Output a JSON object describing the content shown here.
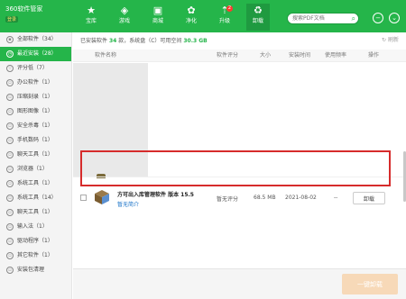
{
  "app": {
    "name": "360软件管家",
    "sub": "登录"
  },
  "nav": [
    {
      "label": "宝库",
      "icon": "star-icon",
      "glyph": "★"
    },
    {
      "label": "游戏",
      "icon": "gamepad-icon",
      "glyph": "🎮"
    },
    {
      "label": "商城",
      "icon": "shop-icon",
      "glyph": "▣"
    },
    {
      "label": "净化",
      "icon": "purify-icon",
      "glyph": "✿"
    },
    {
      "label": "升级",
      "icon": "upgrade-icon",
      "glyph": "⇡",
      "badge": "2"
    },
    {
      "label": "卸载",
      "icon": "trash-icon",
      "glyph": "🗑"
    }
  ],
  "search": {
    "placeholder": "搜索PDF文档"
  },
  "sidebar": {
    "items": [
      {
        "label": "全部软件（34）"
      },
      {
        "label": "最近安装（28）"
      },
      {
        "label": "评分低（7）"
      },
      {
        "label": "办公软件（1）"
      },
      {
        "label": "压缩刻录（1）"
      },
      {
        "label": "图形图像（1）"
      },
      {
        "label": "安全杀毒（1）"
      },
      {
        "label": "手机数码（1）"
      },
      {
        "label": "聊天工具（1）"
      },
      {
        "label": "浏览器（1）"
      },
      {
        "label": "系统工具（1）"
      },
      {
        "label": "系统工具（14）"
      },
      {
        "label": "聊天工具（1）"
      },
      {
        "label": "输入法（1）"
      },
      {
        "label": "驱动程序（1）"
      },
      {
        "label": "其它软件（1）"
      },
      {
        "label": "安装包清理"
      }
    ]
  },
  "summary": {
    "pre": "已安装软件",
    "count": "34",
    "mid": "款，系统盘（C）可用空间",
    "free": "30.3 GB"
  },
  "refresh_label": "刷新",
  "columns": {
    "name": "软件名称",
    "rating": "软件评分",
    "size": "大小",
    "time": "安装时间",
    "freq": "使用频率",
    "op": "操作"
  },
  "app_row": {
    "name": "方可出入库管理软件 版本 15.5",
    "link": "暂无简介",
    "rating": "暂无评分",
    "size": "68.5 MB",
    "date": "2021-08-02",
    "freq": "--",
    "action": "卸载"
  },
  "onekey_label": "一键卸载",
  "colors": {
    "brand": "#25b54a",
    "highlight": "#d62b2b"
  }
}
